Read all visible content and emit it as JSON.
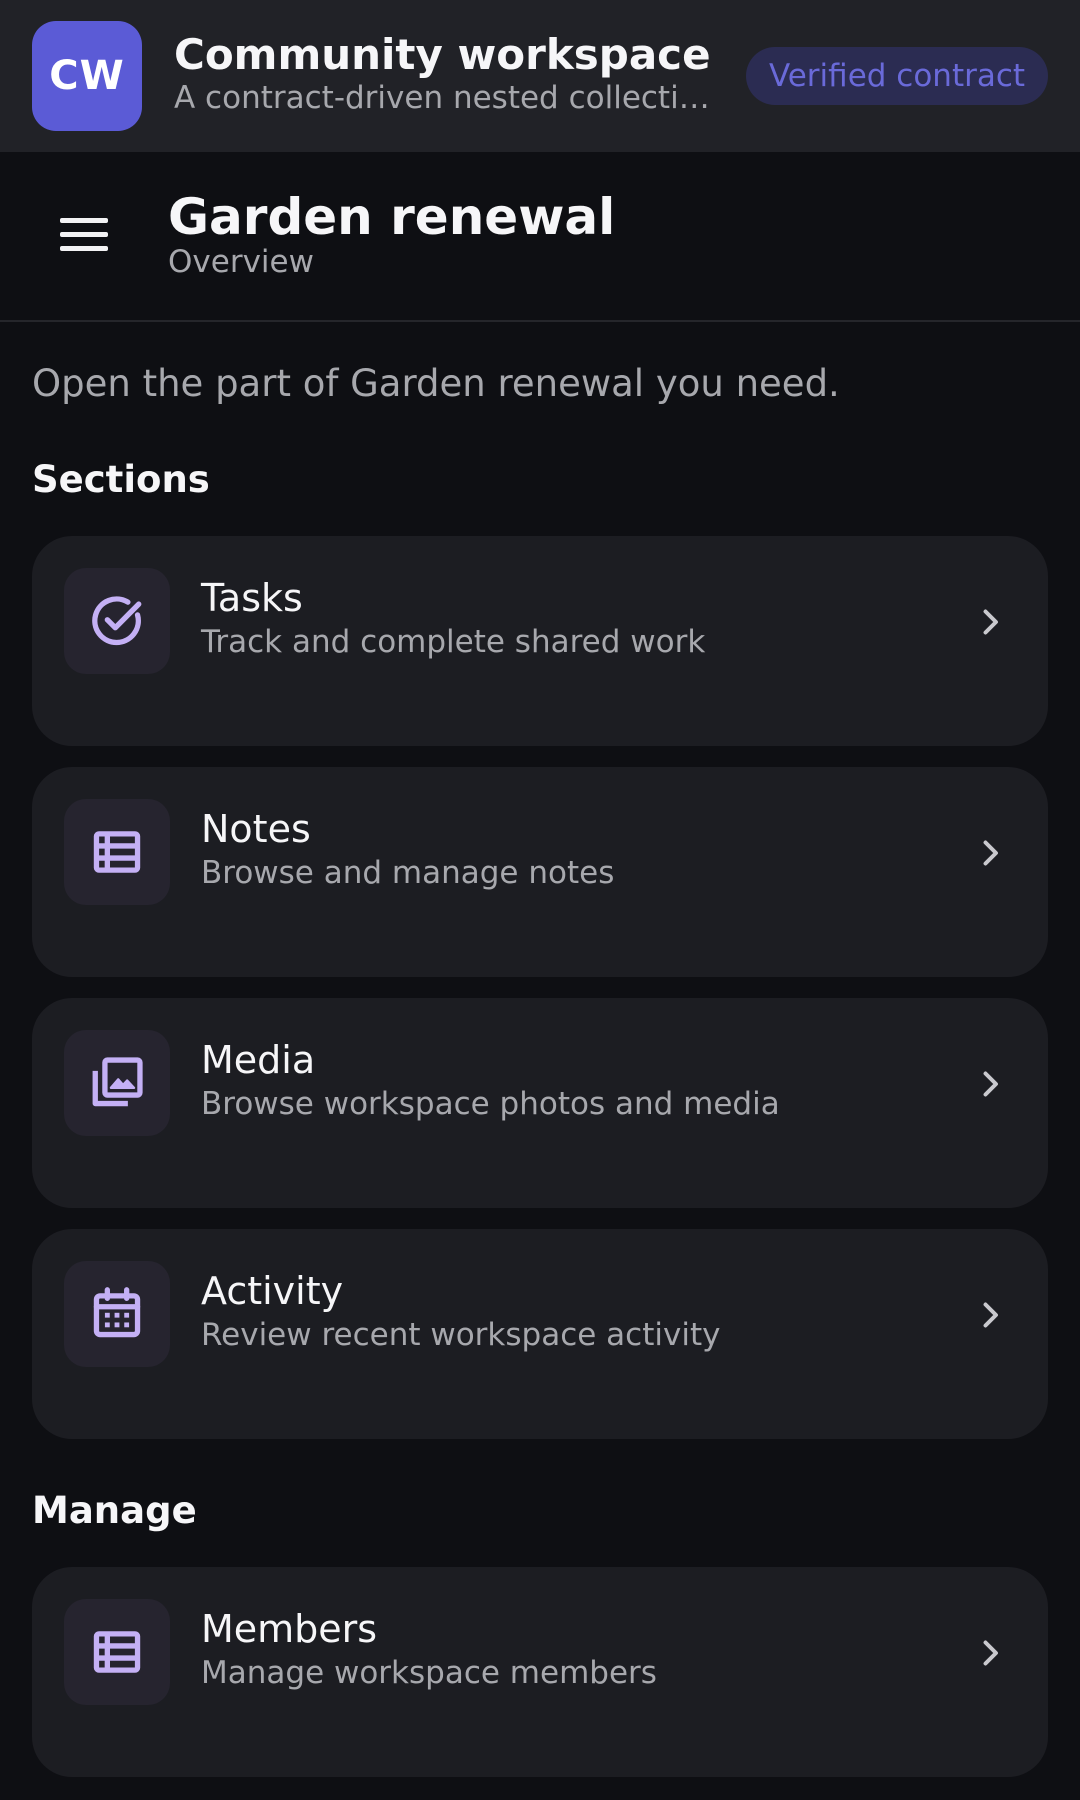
{
  "app": {
    "logo_initials": "CW",
    "title": "Community workspace",
    "subtitle": "A contract-driven nested collection workspace",
    "badge": "Verified contract"
  },
  "page": {
    "title": "Garden renewal",
    "subtitle": "Overview",
    "intro": "Open the part of Garden renewal you need."
  },
  "sections": {
    "heading": "Sections",
    "items": [
      {
        "label": "Tasks",
        "description": "Track and complete shared work",
        "icon": "check-circle-icon"
      },
      {
        "label": "Notes",
        "description": "Browse and manage notes",
        "icon": "list-icon"
      },
      {
        "label": "Media",
        "description": "Browse workspace photos and media",
        "icon": "photo-library-icon"
      },
      {
        "label": "Activity",
        "description": "Review recent workspace activity",
        "icon": "calendar-icon"
      }
    ]
  },
  "manage": {
    "heading": "Manage",
    "items": [
      {
        "label": "Members",
        "description": "Manage workspace members",
        "icon": "list-icon"
      }
    ]
  },
  "colors": {
    "background": "#0e0f13",
    "topbar": "#212227",
    "card": "#1c1d22",
    "accent": "#5b5bd6",
    "icon": "#c4b0f5",
    "muted_text": "#a7a8ad"
  }
}
